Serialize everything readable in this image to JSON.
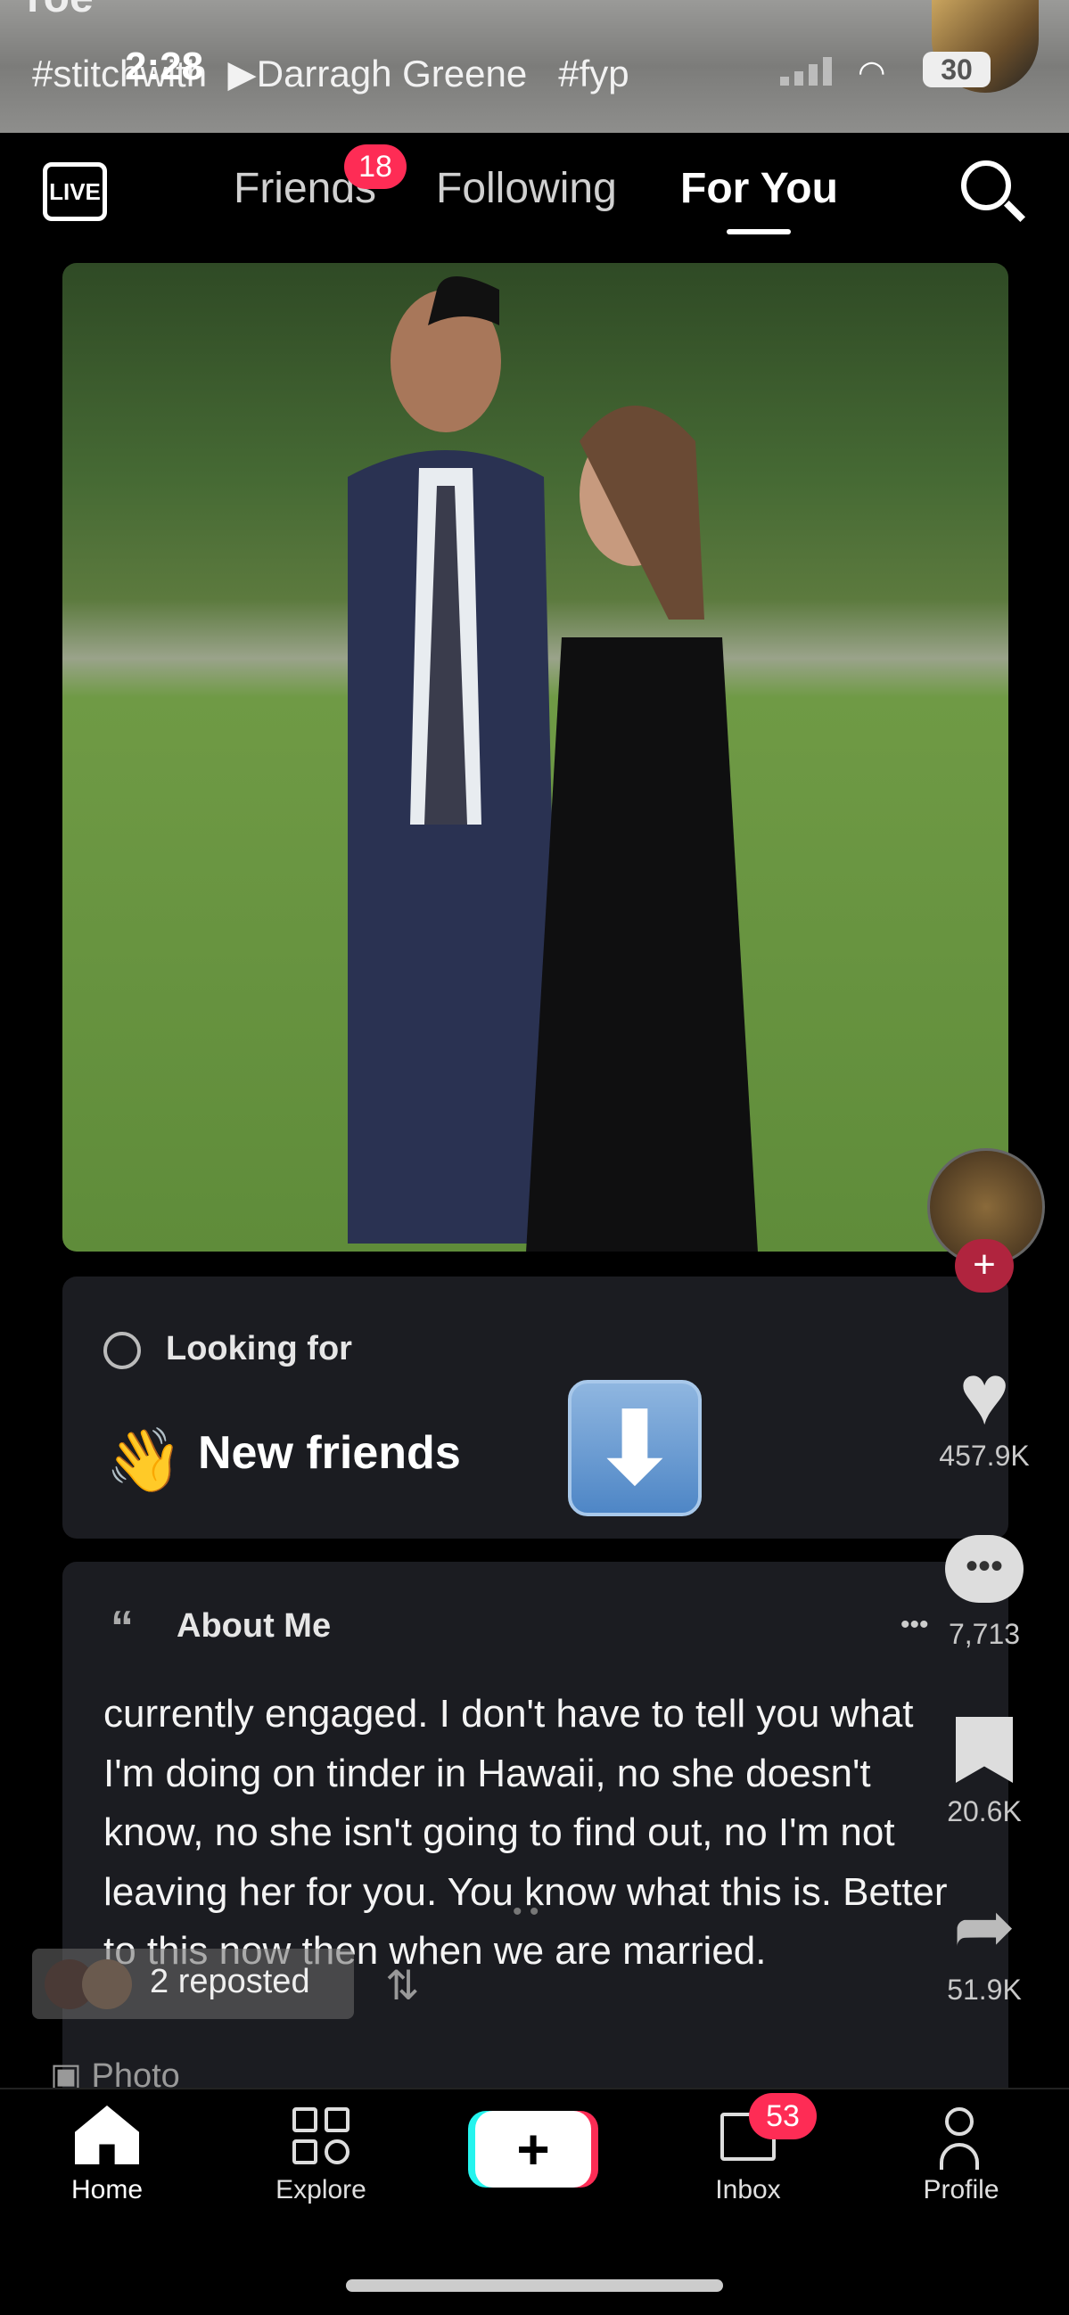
{
  "top_overlay": {
    "partial_text": "roe",
    "caption_hashtag": "#stitchwith",
    "caption_user": "Darragh Greene",
    "caption_tag": "#fyp",
    "time": "2:28",
    "battery": "30"
  },
  "header": {
    "live_label": "LIVE",
    "tabs": [
      {
        "label": "Friends",
        "badge": "18"
      },
      {
        "label": "Following"
      },
      {
        "label": "For You",
        "active": true
      }
    ]
  },
  "card_looking": {
    "label": "Looking for",
    "emoji": "👋",
    "value": "New friends",
    "arrow_emoji": "⬇"
  },
  "card_about": {
    "quote_mark": "66",
    "title": "About Me",
    "text": "currently engaged. I don't have to tell you what I'm doing on tinder in Hawaii, no she doesn't know, no she isn't going to find out, no I'm not leaving her for you. You know what this is. Better to this now then when we are married."
  },
  "rail": {
    "likes": "457.9K",
    "comments": "7,713",
    "bookmarks": "20.6K",
    "shares": "51.9K",
    "more": "•••"
  },
  "repost": {
    "label": "2 reposted"
  },
  "photo_label": "Photo",
  "bottom_nav": {
    "items": [
      "Home",
      "Explore",
      "Inbox",
      "Profile"
    ],
    "inbox_badge": "53",
    "create": "+"
  },
  "colors": {
    "accent": "#fe2c55",
    "cyan": "#25f4ee",
    "card_bg": "#1b1c21"
  }
}
